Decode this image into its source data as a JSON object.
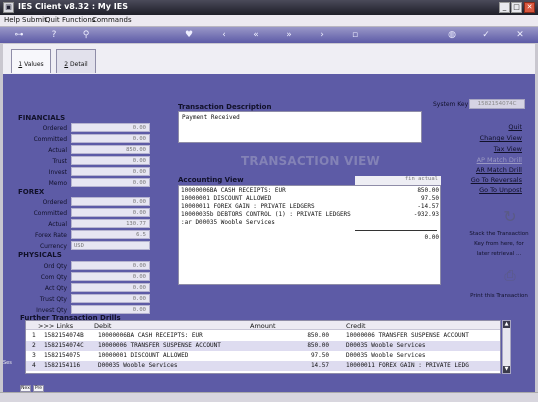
{
  "window": {
    "title": "IES Client v8.32 : My IES",
    "app_icon": "ies-app-icon"
  },
  "menu": [
    "Help",
    "Submit",
    "Quit",
    "Functions",
    "Commands"
  ],
  "toolbar_icons": [
    "key-icon",
    "help-icon",
    "search-icon",
    "heart-icon",
    "back-icon",
    "rewind-icon",
    "fast-forward-icon",
    "forward-icon",
    "blank-icon",
    "stop-icon",
    "globe-icon",
    "check-icon",
    "close-icon"
  ],
  "tabs": [
    {
      "num": "1",
      "label": "Values"
    },
    {
      "num": "2",
      "label": "Detail"
    }
  ],
  "financials": {
    "title": "FINANCIALS",
    "rows": [
      {
        "label": "Ordered",
        "value": "0.00"
      },
      {
        "label": "Committed",
        "value": "0.00"
      },
      {
        "label": "Actual",
        "value": "850.00"
      },
      {
        "label": "Trust",
        "value": "0.00"
      },
      {
        "label": "Invest",
        "value": "0.00"
      },
      {
        "label": "Memo",
        "value": "0.00"
      }
    ]
  },
  "forex": {
    "title": "FOREX",
    "rows": [
      {
        "label": "Ordered",
        "value": "0.00"
      },
      {
        "label": "Committed",
        "value": "0.00"
      },
      {
        "label": "Actual",
        "value": "130.77"
      },
      {
        "label": "Forex Rate",
        "value": "6.5"
      },
      {
        "label": "Currency",
        "value": "USD"
      }
    ]
  },
  "physicals": {
    "title": "PHYSICALS",
    "rows": [
      {
        "label": "Ord Qty",
        "value": "0.00"
      },
      {
        "label": "Com Qty",
        "value": "0.00"
      },
      {
        "label": "Act Qty",
        "value": "0.00"
      },
      {
        "label": "Trust Qty",
        "value": "0.00"
      },
      {
        "label": "Invest Qty",
        "value": "0.00"
      }
    ]
  },
  "transaction": {
    "desc_label": "Transaction Description",
    "description": "Payment Received",
    "view_heading": "TRANSACTION VIEW",
    "system_key_label": "System Key",
    "system_key": "1582154074C"
  },
  "accounting": {
    "label": "Accounting View",
    "col_header": "fin actual",
    "lines": [
      {
        "desc": "10000006BA CASH RECEIPTS: EUR",
        "amount": "850.00"
      },
      {
        "desc": "10000001 DISCOUNT ALLOWED",
        "amount": "97.50"
      },
      {
        "desc": "10000011 FOREX GAIN : PRIVATE LEDGERS",
        "amount": "-14.57"
      },
      {
        "desc": "10000035b DEBTORS CONTROL (1) : PRIVATE LEDGERS",
        "amount": "-932.93"
      },
      {
        "desc": " :ar  D00035 Wooble Services",
        "amount": ""
      }
    ],
    "total": "0.00"
  },
  "right_links": [
    {
      "label": "Quit",
      "enabled": true
    },
    {
      "label": "Change View",
      "enabled": true
    },
    {
      "label": "Tax View",
      "enabled": true
    },
    {
      "label": "AP Match Drill",
      "enabled": false
    },
    {
      "label": "AR Match Drill",
      "enabled": true
    },
    {
      "label": "Go To Reversals",
      "enabled": true
    },
    {
      "label": "Go To Unpost",
      "enabled": true
    }
  ],
  "stack": {
    "icon": "stack-refresh-icon",
    "lines": [
      "Stack the Transaction",
      "Key from here, for",
      "later retrieval ..."
    ]
  },
  "print": {
    "icon": "print-icon",
    "label": "Print this Transaction"
  },
  "drills": {
    "title": "Further Transaction Drills",
    "headers": {
      "links": ">>> Links",
      "debit": "Debit",
      "amount": "Amount",
      "credit": "Credit"
    },
    "rows": [
      {
        "n": "1",
        "key": "1582154074B",
        "debit": "10000006BA CASH RECEIPTS: EUR",
        "amount": "850.00",
        "credit": "10000006 TRANSFER SUSPENSE ACCOUNT"
      },
      {
        "n": "2",
        "key": "1582154074C",
        "debit": "10000006 TRANSFER SUSPENSE ACCOUNT",
        "amount": "850.00",
        "credit": "D00035 Wooble Services"
      },
      {
        "n": "3",
        "key": "1582154075",
        "debit": "10000001 DISCOUNT ALLOWED",
        "amount": "97.50",
        "credit": "D00035 Wooble Services"
      },
      {
        "n": "4",
        "key": "1582154116",
        "debit": "D00035 Wooble Services",
        "amount": "14.57",
        "credit": "10000011 FOREX GAIN : PRIVATE LEDG"
      }
    ]
  },
  "nav_buttons": [
    "Nex",
    "Pre"
  ],
  "side_marker": "Ses"
}
